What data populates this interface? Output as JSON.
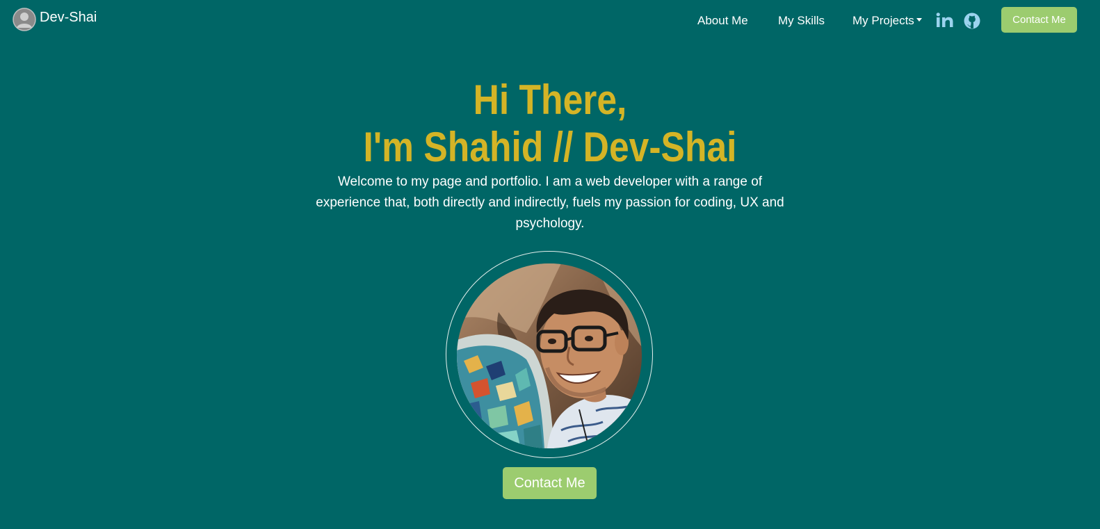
{
  "navbar": {
    "brand_text": "Dev-Shai",
    "brand_icon": "user-avatar-icon",
    "links": [
      {
        "label": "About Me"
      },
      {
        "label": "My Skills"
      },
      {
        "label": "My Projects"
      }
    ],
    "social": [
      {
        "icon": "linkedin-icon",
        "label": "in"
      },
      {
        "icon": "github-icon"
      }
    ],
    "contact_label": "Contact Me"
  },
  "hero": {
    "title_line1": "Hi There,",
    "title_line2": "I'm Shahid // Dev-Shai",
    "intro": "Welcome to my page and portfolio. I am a web developer with a range of experience that, both directly and indirectly, fuels my passion for coding, UX and psychology.",
    "contact_label": "Contact Me"
  },
  "colors": {
    "background": "#006666",
    "title": "#D4B426",
    "button": "#9CCC6F",
    "text": "#FFFFFF",
    "social_icon": "#9BD3EE"
  }
}
